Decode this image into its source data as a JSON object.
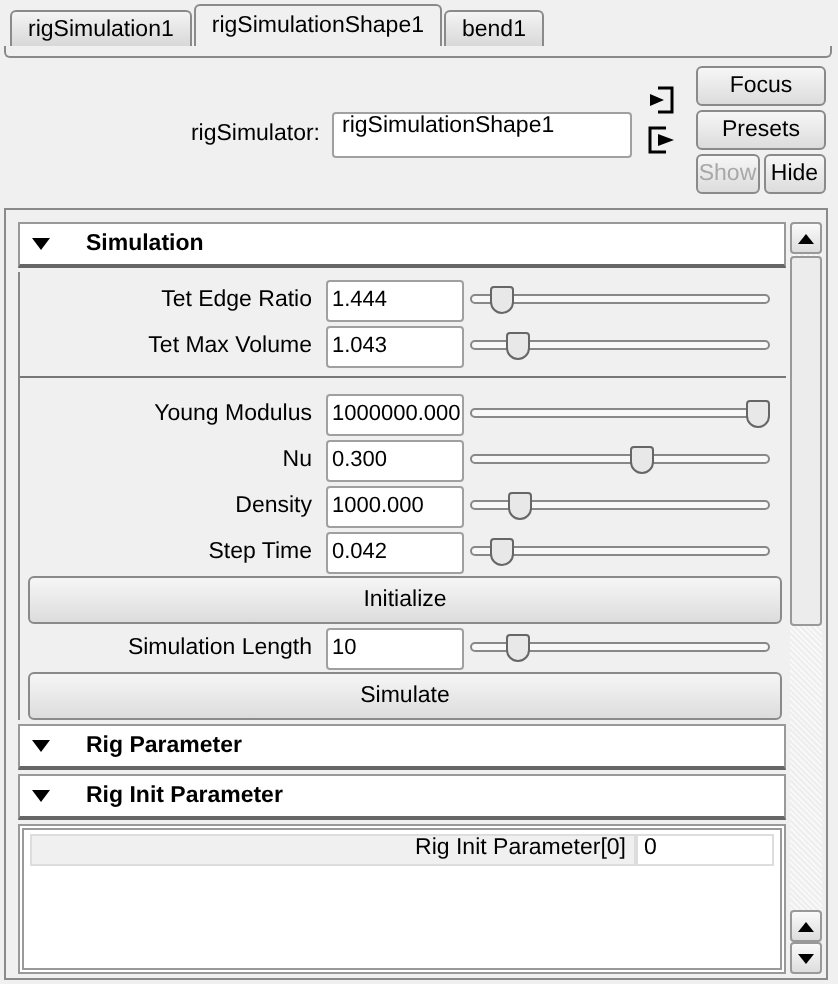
{
  "tabs": [
    {
      "label": "rigSimulation1",
      "selected": false
    },
    {
      "label": "rigSimulationShape1",
      "selected": true
    },
    {
      "label": "bend1",
      "selected": false
    }
  ],
  "header": {
    "label": "rigSimulator:",
    "value": "rigSimulationShape1",
    "buttons": [
      {
        "label": "Focus",
        "disabled": false
      },
      {
        "label": "Presets",
        "disabled": false
      }
    ],
    "small_buttons": [
      {
        "label": "Show",
        "disabled": true
      },
      {
        "label": "Hide",
        "disabled": false
      }
    ]
  },
  "sections": [
    {
      "title": "Simulation",
      "expanded": true,
      "items": [
        {
          "kind": "slider",
          "label": "Tet Edge Ratio",
          "value": "1.444",
          "level": 0.07
        },
        {
          "kind": "slider",
          "label": "Tet Max Volume",
          "value": "1.043",
          "level": 0.13
        },
        {
          "kind": "separator"
        },
        {
          "kind": "slider",
          "label": "Young Modulus",
          "value": "1000000.000",
          "level": 1.0
        },
        {
          "kind": "slider",
          "label": "Nu",
          "value": "0.300",
          "level": 0.58
        },
        {
          "kind": "slider",
          "label": "Density",
          "value": "1000.000",
          "level": 0.14
        },
        {
          "kind": "slider",
          "label": "Step Time",
          "value": "0.042",
          "level": 0.07
        },
        {
          "kind": "button",
          "label": "Initialize"
        },
        {
          "kind": "slider",
          "label": "Simulation Length",
          "value": "10",
          "level": 0.13
        },
        {
          "kind": "button",
          "label": "Simulate"
        }
      ]
    },
    {
      "title": "Rig Parameter",
      "expanded": true
    },
    {
      "title": "Rig Init Parameter",
      "expanded": true,
      "table": [
        {
          "name": "Rig Init Parameter[0]",
          "value": "0"
        }
      ]
    }
  ]
}
